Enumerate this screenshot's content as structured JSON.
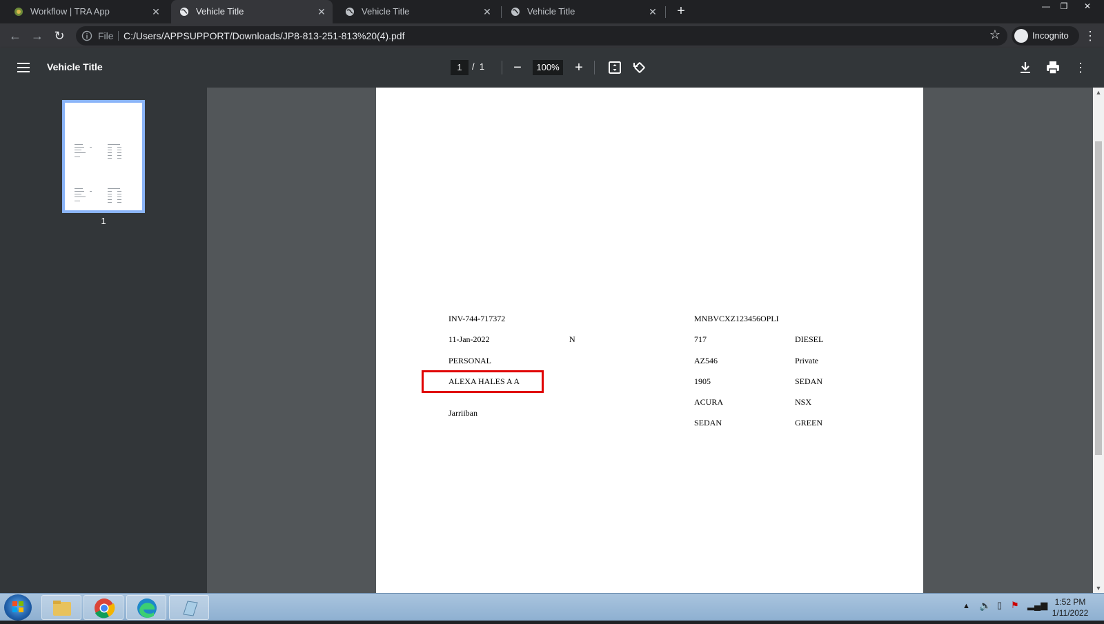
{
  "tabs": [
    {
      "title": "Workflow | TRA App",
      "active": false
    },
    {
      "title": "Vehicle Title",
      "active": true
    },
    {
      "title": "Vehicle Title",
      "active": false
    },
    {
      "title": "Vehicle Title",
      "active": false
    }
  ],
  "omnibox": {
    "scheme_label": "File",
    "url": "C:/Users/APPSUPPORT/Downloads/JP8-813-251-813%20(4).pdf"
  },
  "profile": {
    "label": "Incognito"
  },
  "pdf_toolbar": {
    "title": "Vehicle Title",
    "current_page": "1",
    "page_separator": "/",
    "total_pages": "1",
    "zoom": "100%"
  },
  "sidebar": {
    "thumbnail_label": "1"
  },
  "document": {
    "invoice_no": "INV-744-717372",
    "vin": "MNBVCXZ123456OPLI",
    "date": "11-Jan-2022",
    "flag": "N",
    "code": "717",
    "fuel": "DIESEL",
    "usage": "PERSONAL",
    "plate": "AZ546",
    "ownership": "Private",
    "owner_name": "ALEXA HALES A A",
    "year": "1905",
    "body_type": "SEDAN",
    "make": "ACURA",
    "model": "NSX",
    "city": "Jarriiban",
    "body_class": "SEDAN",
    "color": "GREEN"
  },
  "taskbar": {
    "time": "1:52 PM",
    "date": "1/11/2022"
  },
  "colors": {
    "highlight_border": "#e00000",
    "thumbnail_border": "#8ab4f8"
  }
}
